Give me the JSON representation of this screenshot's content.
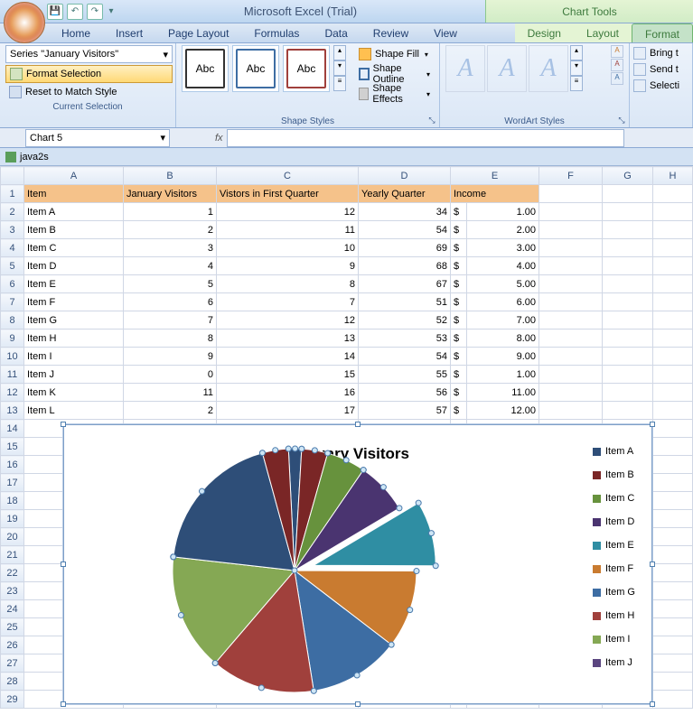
{
  "app_title": "Microsoft Excel (Trial)",
  "context_tab": "Chart Tools",
  "tabs": [
    "Home",
    "Insert",
    "Page Layout",
    "Formulas",
    "Data",
    "Review",
    "View"
  ],
  "ctx_tabs": [
    "Design",
    "Layout",
    "Format"
  ],
  "active_ctx_tab": "Format",
  "ribbon": {
    "cursel": {
      "combo": "Series \"January Visitors\"",
      "format_selection": "Format Selection",
      "reset": "Reset to Match Style",
      "label": "Current Selection"
    },
    "shape_styles": {
      "abc": "Abc",
      "fill": "Shape Fill",
      "outline": "Shape Outline",
      "effects": "Shape Effects",
      "label": "Shape Styles"
    },
    "wordart": {
      "label": "WordArt Styles",
      "glyph": "A"
    },
    "arrange": {
      "bring": "Bring t",
      "send": "Send t",
      "selection": "Selecti"
    }
  },
  "name_box": "Chart 5",
  "fx_label": "fx",
  "workbook": "java2s",
  "columns": [
    "A",
    "B",
    "C",
    "D",
    "E",
    "F",
    "G",
    "H"
  ],
  "headers": {
    "item": "Item",
    "jan": "January Visitors",
    "q1": "Vistors in First Quarter",
    "yq": "Yearly Quarter",
    "inc": "Income"
  },
  "rows": [
    {
      "n": 1
    },
    {
      "n": 2,
      "item": "Item A",
      "jan": 1,
      "q1": 12,
      "yq": 34,
      "cur": "$",
      "inc": "1.00"
    },
    {
      "n": 3,
      "item": "Item B",
      "jan": 2,
      "q1": 11,
      "yq": 54,
      "cur": "$",
      "inc": "2.00"
    },
    {
      "n": 4,
      "item": "Item C",
      "jan": 3,
      "q1": 10,
      "yq": 69,
      "cur": "$",
      "inc": "3.00"
    },
    {
      "n": 5,
      "item": "Item D",
      "jan": 4,
      "q1": 9,
      "yq": 68,
      "cur": "$",
      "inc": "4.00"
    },
    {
      "n": 6,
      "item": "Item E",
      "jan": 5,
      "q1": 8,
      "yq": 67,
      "cur": "$",
      "inc": "5.00"
    },
    {
      "n": 7,
      "item": "Item F",
      "jan": 6,
      "q1": 7,
      "yq": 51,
      "cur": "$",
      "inc": "6.00"
    },
    {
      "n": 8,
      "item": "Item G",
      "jan": 7,
      "q1": 12,
      "yq": 52,
      "cur": "$",
      "inc": "7.00"
    },
    {
      "n": 9,
      "item": "Item H",
      "jan": 8,
      "q1": 13,
      "yq": 53,
      "cur": "$",
      "inc": "8.00"
    },
    {
      "n": 10,
      "item": "Item I",
      "jan": 9,
      "q1": 14,
      "yq": 54,
      "cur": "$",
      "inc": "9.00"
    },
    {
      "n": 11,
      "item": "Item J",
      "jan": 0,
      "q1": 15,
      "yq": 55,
      "cur": "$",
      "inc": "1.00"
    },
    {
      "n": 12,
      "item": "Item K",
      "jan": 11,
      "q1": 16,
      "yq": 56,
      "cur": "$",
      "inc": "11.00"
    },
    {
      "n": 13,
      "item": "Item L",
      "jan": 2,
      "q1": 17,
      "yq": 57,
      "cur": "$",
      "inc": "12.00"
    }
  ],
  "empty_rows": [
    14,
    15,
    16,
    17,
    18,
    19,
    20,
    21,
    22,
    23,
    24,
    25,
    26,
    27,
    28,
    29
  ],
  "chart": {
    "title": "January Visitors",
    "legend": [
      {
        "label": "Item A",
        "color": "#2e4e78"
      },
      {
        "label": "Item B",
        "color": "#7a2626"
      },
      {
        "label": "Item C",
        "color": "#67923d"
      },
      {
        "label": "Item D",
        "color": "#4a3470"
      },
      {
        "label": "Item E",
        "color": "#2f8ea3"
      },
      {
        "label": "Item F",
        "color": "#c97b30"
      },
      {
        "label": "Item G",
        "color": "#3d6da3"
      },
      {
        "label": "Item H",
        "color": "#a0403c"
      },
      {
        "label": "Item I",
        "color": "#85a854"
      },
      {
        "label": "Item J",
        "color": "#5b4680"
      }
    ]
  },
  "chart_data": {
    "type": "pie",
    "title": "January Visitors",
    "categories": [
      "Item A",
      "Item B",
      "Item C",
      "Item D",
      "Item E",
      "Item F",
      "Item G",
      "Item H",
      "Item I",
      "Item J",
      "Item K",
      "Item L"
    ],
    "values": [
      1,
      2,
      3,
      4,
      5,
      6,
      7,
      8,
      9,
      0,
      11,
      2
    ],
    "note": "Slice for series 'January Visitors' shown selected/exploded",
    "colors": [
      "#2e4e78",
      "#7a2626",
      "#67923d",
      "#4a3470",
      "#2f8ea3",
      "#c97b30",
      "#3d6da3",
      "#a0403c",
      "#85a854",
      "#5b4680",
      "#2e4e78",
      "#7a2626"
    ]
  }
}
